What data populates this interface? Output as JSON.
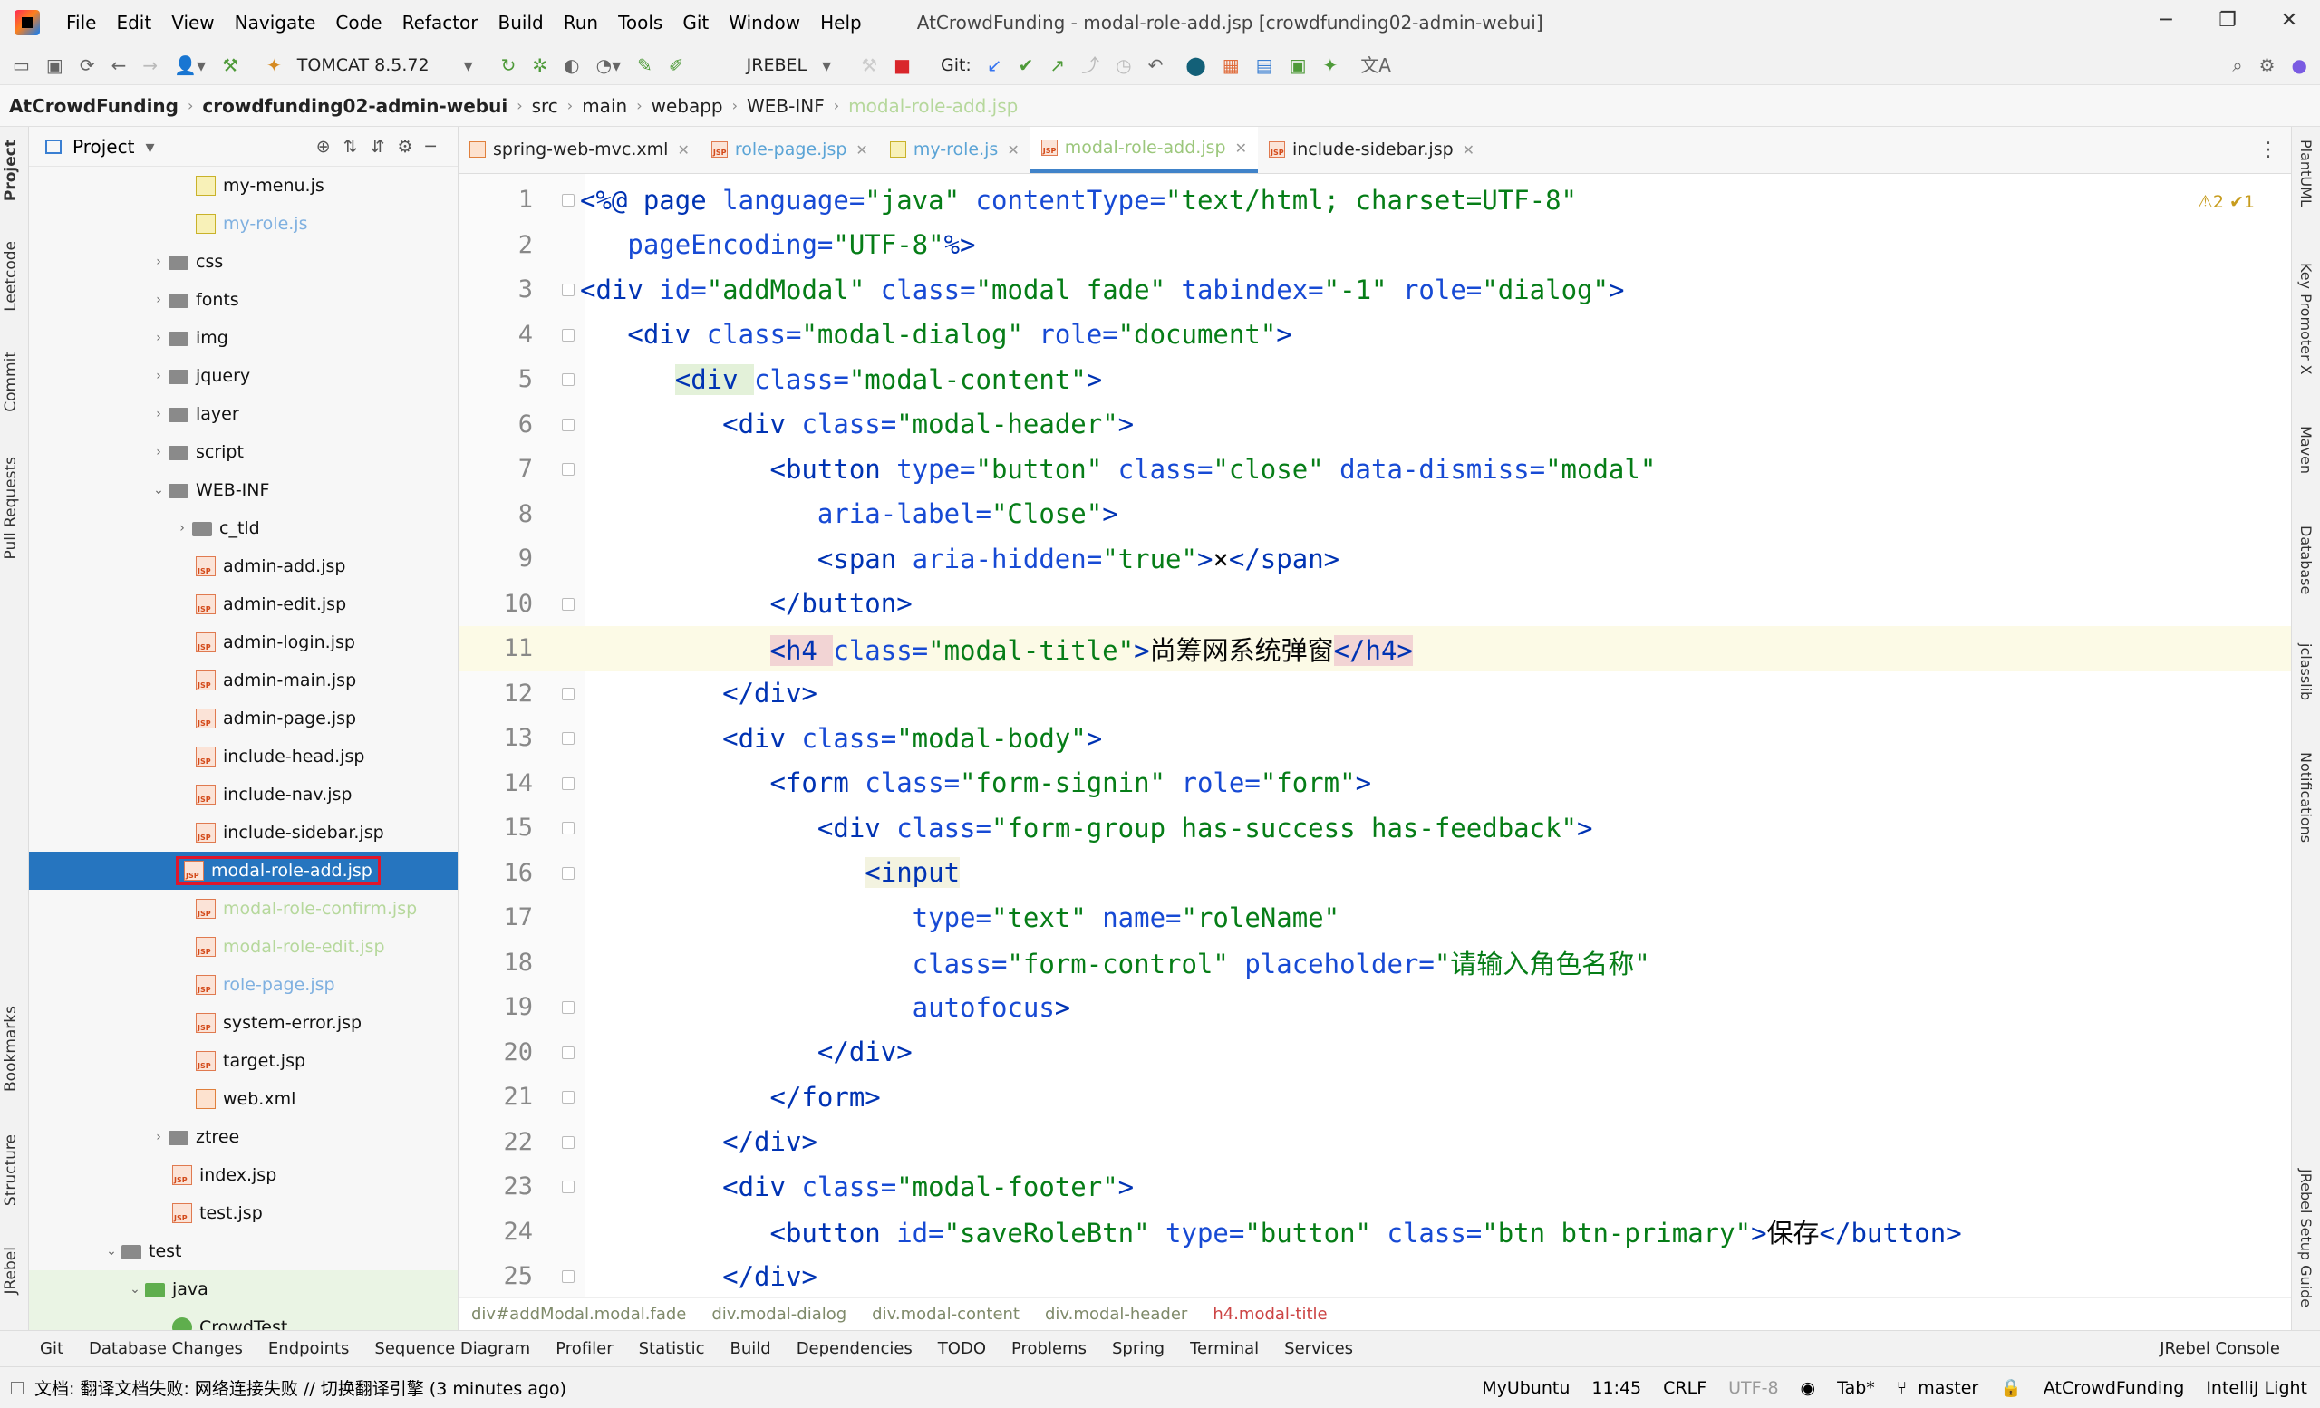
{
  "menu": [
    "File",
    "Edit",
    "View",
    "Navigate",
    "Code",
    "Refactor",
    "Build",
    "Run",
    "Tools",
    "Git",
    "Window",
    "Help"
  ],
  "window_title": "AtCrowdFunding - modal-role-add.jsp [crowdfunding02-admin-webui]",
  "toolbar": {
    "run_config": "TOMCAT 8.5.72",
    "jrebel": "JREBEL",
    "git": "Git:"
  },
  "breadcrumb": [
    "AtCrowdFunding",
    "crowdfunding02-admin-webui",
    "src",
    "main",
    "webapp",
    "WEB-INF",
    "modal-role-add.jsp"
  ],
  "project": {
    "title": "Project"
  },
  "left_tabs": [
    "Project",
    "Leetcode",
    "Commit",
    "Pull Requests",
    "Bookmarks",
    "Structure",
    "JRebel"
  ],
  "right_tabs": [
    "PlantUML",
    "Key Promoter X",
    "Maven",
    "Database",
    "jclasslib",
    "Notifications",
    "JRebel Setup Guide"
  ],
  "tree": [
    {
      "label": "my-menu.js"
    },
    {
      "label": "my-role.js"
    },
    {
      "label": "css"
    },
    {
      "label": "fonts"
    },
    {
      "label": "img"
    },
    {
      "label": "jquery"
    },
    {
      "label": "layer"
    },
    {
      "label": "script"
    },
    {
      "label": "WEB-INF"
    },
    {
      "label": "c_tld"
    },
    {
      "label": "admin-add.jsp"
    },
    {
      "label": "admin-edit.jsp"
    },
    {
      "label": "admin-login.jsp"
    },
    {
      "label": "admin-main.jsp"
    },
    {
      "label": "admin-page.jsp"
    },
    {
      "label": "include-head.jsp"
    },
    {
      "label": "include-nav.jsp"
    },
    {
      "label": "include-sidebar.jsp"
    },
    {
      "label": "modal-role-add.jsp"
    },
    {
      "label": "modal-role-confirm.jsp"
    },
    {
      "label": "modal-role-edit.jsp"
    },
    {
      "label": "role-page.jsp"
    },
    {
      "label": "system-error.jsp"
    },
    {
      "label": "target.jsp"
    },
    {
      "label": "web.xml"
    },
    {
      "label": "ztree"
    },
    {
      "label": "index.jsp"
    },
    {
      "label": "test.jsp"
    },
    {
      "label": "test"
    },
    {
      "label": "java"
    },
    {
      "label": "CrowdTest"
    }
  ],
  "tabs": [
    {
      "label": "spring-web-mvc.xml"
    },
    {
      "label": "role-page.jsp"
    },
    {
      "label": "my-role.js"
    },
    {
      "label": "modal-role-add.jsp"
    },
    {
      "label": "include-sidebar.jsp"
    }
  ],
  "inspections": "⚠2 ✔1",
  "code": [
    "1",
    "2",
    "3",
    "4",
    "5",
    "6",
    "7",
    "8",
    "9",
    "10",
    "11",
    "12",
    "13",
    "14",
    "15",
    "16",
    "17",
    "18",
    "19",
    "20",
    "21",
    "22",
    "23",
    "24",
    "25"
  ],
  "editor_crumbs": [
    "div#addModal.modal.fade",
    "div.modal-dialog",
    "div.modal-content",
    "div.modal-header",
    "h4.modal-title"
  ],
  "toolwindows": [
    "Git",
    "Database Changes",
    "Endpoints",
    "Sequence Diagram",
    "Profiler",
    "Statistic",
    "Build",
    "Dependencies",
    "TODO",
    "Problems",
    "Spring",
    "Terminal",
    "Services",
    "JRebel Console"
  ],
  "status": {
    "message": "文档: 翻译文档失败: 网络连接失败 // 切换翻译引擎 (3 minutes ago)",
    "host": "MyUbuntu",
    "time": "11:45",
    "eol": "CRLF",
    "encoding": "UTF-8",
    "indent": "Tab*",
    "branch": "master",
    "project": "AtCrowdFunding",
    "theme": "IntelliJ Light"
  },
  "code_strings": {
    "l1a": "<%@ ",
    "l1b": "page ",
    "l1c": "language=",
    "l1d": "\"java\"",
    "l1e": " contentType=",
    "l1f": "\"text/html; charset=UTF-8\"",
    "l2a": "pageEncoding=",
    "l2b": "\"UTF-8\"",
    "l2c": "%>",
    "l3a": "<div ",
    "l3b": "id=",
    "l3c": "\"addModal\"",
    "l3d": " class=",
    "l3e": "\"modal fade\"",
    "l3f": " tabindex=",
    "l3g": "\"-1\"",
    "l3h": " role=",
    "l3i": "\"dialog\"",
    "l3j": ">",
    "l4a": "<div ",
    "l4b": "class=",
    "l4c": "\"modal-dialog\"",
    "l4d": " role=",
    "l4e": "\"document\"",
    "l4f": ">",
    "l5a": "<div ",
    "l5b": "class=",
    "l5c": "\"modal-content\"",
    "l5d": ">",
    "l6a": "<div ",
    "l6b": "class=",
    "l6c": "\"modal-header\"",
    "l6d": ">",
    "l7a": "<button ",
    "l7b": "type=",
    "l7c": "\"button\"",
    "l7d": " class=",
    "l7e": "\"close\"",
    "l7f": " data-dismiss=",
    "l7g": "\"modal\"",
    "l8a": "aria-label=",
    "l8b": "\"Close\"",
    "l8c": ">",
    "l9a": "<span ",
    "l9b": "aria-hidden=",
    "l9c": "\"true\"",
    "l9d": ">",
    "l9e": "×",
    "l9f": "</span>",
    "l10a": "</button>",
    "l11a": "<h4 ",
    "l11b": "class=",
    "l11c": "\"modal-title\"",
    "l11d": ">",
    "l11e": "尚筹网系统弹窗",
    "l11f": "</h4>",
    "l12a": "</div>",
    "l13a": "<div ",
    "l13b": "class=",
    "l13c": "\"modal-body\"",
    "l13d": ">",
    "l14a": "<form ",
    "l14b": "class=",
    "l14c": "\"form-signin\"",
    "l14d": " role=",
    "l14e": "\"form\"",
    "l14f": ">",
    "l15a": "<div ",
    "l15b": "class=",
    "l15c": "\"form-group has-success has-feedback\"",
    "l15d": ">",
    "l16a": "<input",
    "l17a": "type=",
    "l17b": "\"text\"",
    "l17c": " name=",
    "l17d": "\"roleName\"",
    "l18a": "class=",
    "l18b": "\"form-control\"",
    "l18c": " placeholder=",
    "l18d": "\"请输入角色名称\"",
    "l19a": "autofocus",
    "l19b": ">",
    "l20a": "</div>",
    "l21a": "</form>",
    "l22a": "</div>",
    "l23a": "<div ",
    "l23b": "class=",
    "l23c": "\"modal-footer\"",
    "l23d": ">",
    "l24a": "<button ",
    "l24b": "id=",
    "l24c": "\"saveRoleBtn\"",
    "l24d": " type=",
    "l24e": "\"button\"",
    "l24f": " class=",
    "l24g": "\"btn btn-primary\"",
    "l24h": ">",
    "l24i": "保存",
    "l24j": "</button>",
    "l25a": "</div>"
  }
}
